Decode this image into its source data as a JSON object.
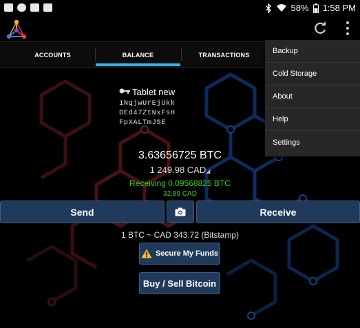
{
  "status_bar": {
    "battery": "58%",
    "time": "1:58 PM"
  },
  "tabs": [
    {
      "label": "ACCOUNTS"
    },
    {
      "label": "BALANCE"
    },
    {
      "label": "TRANSACTIONS"
    }
  ],
  "active_tab": "BALANCE",
  "wallet": {
    "name": "Tablet new",
    "address_lines": [
      "1NqjwUrEjUkk",
      "DEd47ZtNxFsH",
      "FpXALTmJSE"
    ]
  },
  "balance": {
    "btc": "3.63656725 BTC",
    "fiat": "1 249.98 CAD",
    "receiving": "Receiving 0.09568825 BTC",
    "receiving_fiat": "32.89 CAD"
  },
  "actions": {
    "send": "Send",
    "receive": "Receive"
  },
  "rate": "1 BTC ~ CAD 343.72 (Bitstamp)",
  "secure_funds": "Secure My Funds",
  "buy_sell": "Buy / Sell Bitcoin",
  "menu": [
    "Backup",
    "Cold Storage",
    "About",
    "Help",
    "Settings"
  ],
  "colors": {
    "accent": "#33b5e5",
    "receiving": "#36d21e",
    "button": "#1f3a5a"
  },
  "icons": {
    "status_left": [
      "image-icon",
      "cloud-icon",
      "android-icon",
      "photo-icon"
    ],
    "status_right": [
      "bluetooth-icon",
      "wifi-icon",
      "battery-icon"
    ],
    "app": "mycelium-logo-icon",
    "refresh": "refresh-icon",
    "overflow": "overflow-menu-icon",
    "wallet": "key-icon",
    "camera": "camera-icon",
    "warning": "warning-icon"
  }
}
